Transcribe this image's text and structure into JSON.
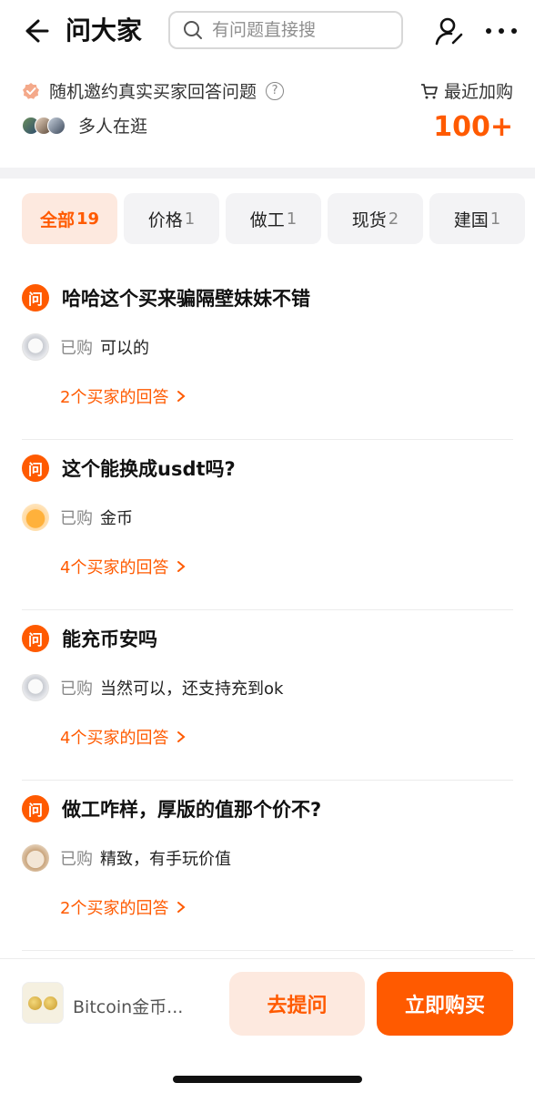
{
  "header": {
    "title": "问大家",
    "search_placeholder": "有问题直接搜"
  },
  "info": {
    "invite_text": "随机邀约真实买家回答问题",
    "help_glyph": "?",
    "browse_text": "多人在逛",
    "recent_label": "最近加购",
    "recent_count": "100+"
  },
  "tabs": [
    {
      "label": "全部",
      "count": "19",
      "active": true
    },
    {
      "label": "价格",
      "count": "1"
    },
    {
      "label": "做工",
      "count": "1"
    },
    {
      "label": "现货",
      "count": "2"
    },
    {
      "label": "建国",
      "count": "1"
    }
  ],
  "questions": [
    {
      "badge": "问",
      "question": "哈哈这个买来骗隔壁妹妹不错",
      "tag": "已购",
      "answer": "可以的",
      "more": "2个买家的回答"
    },
    {
      "badge": "问",
      "question": "这个能换成usdt吗?",
      "tag": "已购",
      "answer": "金币",
      "more": "4个买家的回答"
    },
    {
      "badge": "问",
      "question": "能充币安吗",
      "tag": "已购",
      "answer": "当然可以，还支持充到ok",
      "more": "4个买家的回答"
    },
    {
      "badge": "问",
      "question": "做工咋样，厚版的值那个价不?",
      "tag": "已购",
      "answer": "精致，有手玩价值",
      "more": "2个买家的回答"
    }
  ],
  "bottom": {
    "product_name": "Bitcoin金币...",
    "ask_label": "去提问",
    "buy_label": "立即购买"
  },
  "colors": {
    "accent": "#ff5a00",
    "accent_light": "#fde9df"
  }
}
